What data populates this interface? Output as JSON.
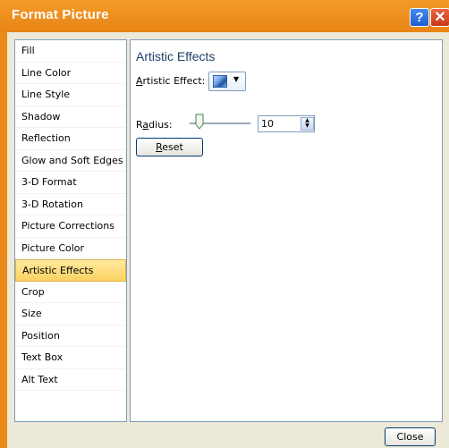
{
  "window": {
    "title": "Format Picture",
    "help_label": "?",
    "close_glyph": "✕"
  },
  "sidebar": {
    "items": [
      {
        "label": "Fill"
      },
      {
        "label": "Line Color"
      },
      {
        "label": "Line Style"
      },
      {
        "label": "Shadow"
      },
      {
        "label": "Reflection"
      },
      {
        "label": "Glow and Soft Edges"
      },
      {
        "label": "3-D Format"
      },
      {
        "label": "3-D Rotation"
      },
      {
        "label": "Picture Corrections"
      },
      {
        "label": "Picture Color"
      },
      {
        "label": "Artistic Effects"
      },
      {
        "label": "Crop"
      },
      {
        "label": "Size"
      },
      {
        "label": "Position"
      },
      {
        "label": "Text Box"
      },
      {
        "label": "Alt Text"
      }
    ],
    "selected_index": 10
  },
  "panel": {
    "heading": "Artistic Effects",
    "artistic_effect": {
      "label_mnemonic": "A",
      "label_rest": "rtistic Effect:"
    },
    "radius": {
      "label_pre": "R",
      "label_mnemonic": "a",
      "label_rest": "dius:",
      "value": "10"
    },
    "reset": {
      "mnemonic": "R",
      "rest": "eset"
    }
  },
  "footer": {
    "close_label": "Close"
  },
  "colors": {
    "title_bar": "#e98a1a",
    "selected_item": "#fcd161",
    "panel_border": "#7f9db9"
  }
}
